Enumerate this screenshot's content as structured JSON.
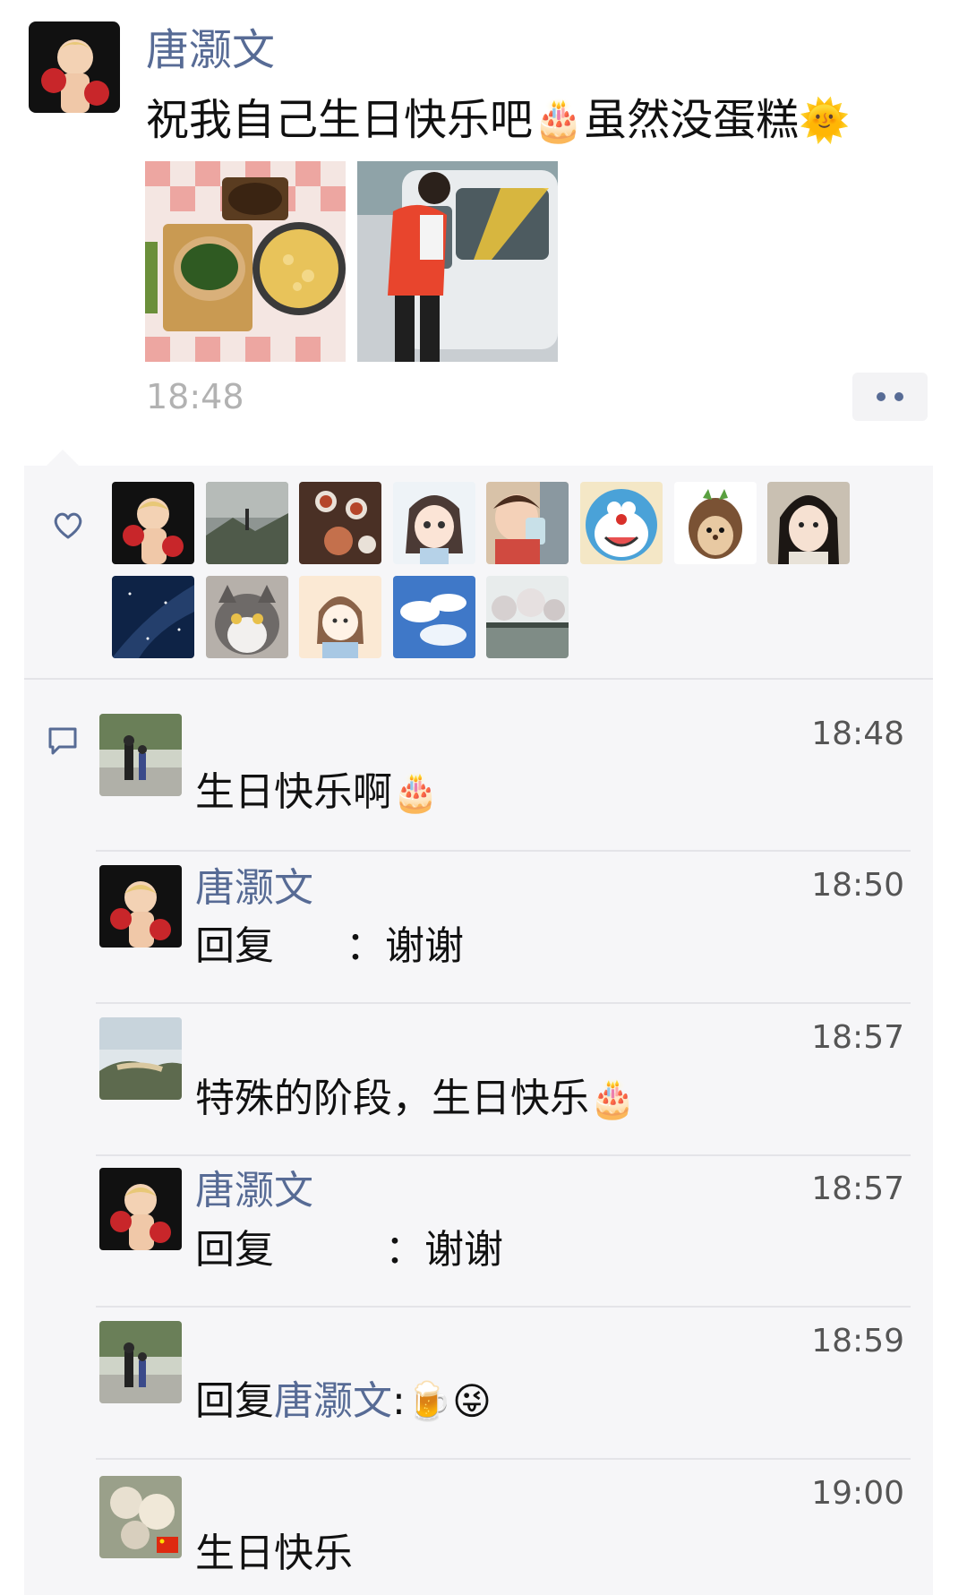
{
  "post": {
    "author": "唐灏文",
    "text": "祝我自己生日快乐吧",
    "emoji_cake": "🎂",
    "text_2": "虽然没蛋糕",
    "emoji_sun": "🌞",
    "time": "18:48",
    "photos": [
      "food-spread-photo",
      "person-at-car-photo"
    ]
  },
  "likes": {
    "icon": "heart-icon",
    "avatars": [
      "boxer-boy",
      "foggy-mountain",
      "tea-set",
      "anime-girl",
      "child-drinking",
      "doraemon",
      "hedgehog",
      "woman-portrait",
      "starry-sky",
      "gray-cat",
      "cartoon-girl",
      "blue-sky-clouds",
      "lake-trees"
    ]
  },
  "comments": [
    {
      "name": "",
      "time": "18:48",
      "text": "生日快乐啊",
      "emoji": "🎂"
    },
    {
      "name": "唐灏文",
      "time": "18:50",
      "prefix": "回复",
      "text": "：谢谢"
    },
    {
      "name": "",
      "time": "18:57",
      "text": "特殊的阶段，生日快乐",
      "emoji": "🎂"
    },
    {
      "name": "唐灏文",
      "time": "18:57",
      "prefix": "回复",
      "text": "：谢谢"
    },
    {
      "name": "",
      "time": "18:59",
      "prefix": "回复",
      "link": "唐灏文",
      "text": ":",
      "emoji": "🍺😜"
    },
    {
      "name": "",
      "time": "19:00",
      "text": "生日快乐"
    }
  ],
  "colors": {
    "link": "#576b95",
    "panel": "#f6f6f8",
    "time": "#b2b2b2"
  }
}
